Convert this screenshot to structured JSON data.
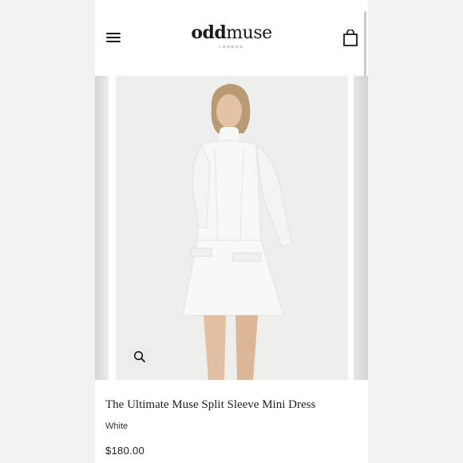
{
  "header": {
    "logo_primary": "odd",
    "logo_secondary": "muse",
    "logo_sub": "LONDON",
    "menu_icon": "hamburger-menu-icon",
    "cart_icon": "shopping-bag-icon"
  },
  "gallery": {
    "zoom_icon": "magnifier-icon"
  },
  "product": {
    "title": "The Ultimate Muse Split Sleeve Mini Dress",
    "color": "White",
    "price": "$180.00"
  },
  "colors": {
    "text": "#1a1a1a",
    "background": "#ffffff",
    "image_backdrop": "#eeeeec"
  }
}
